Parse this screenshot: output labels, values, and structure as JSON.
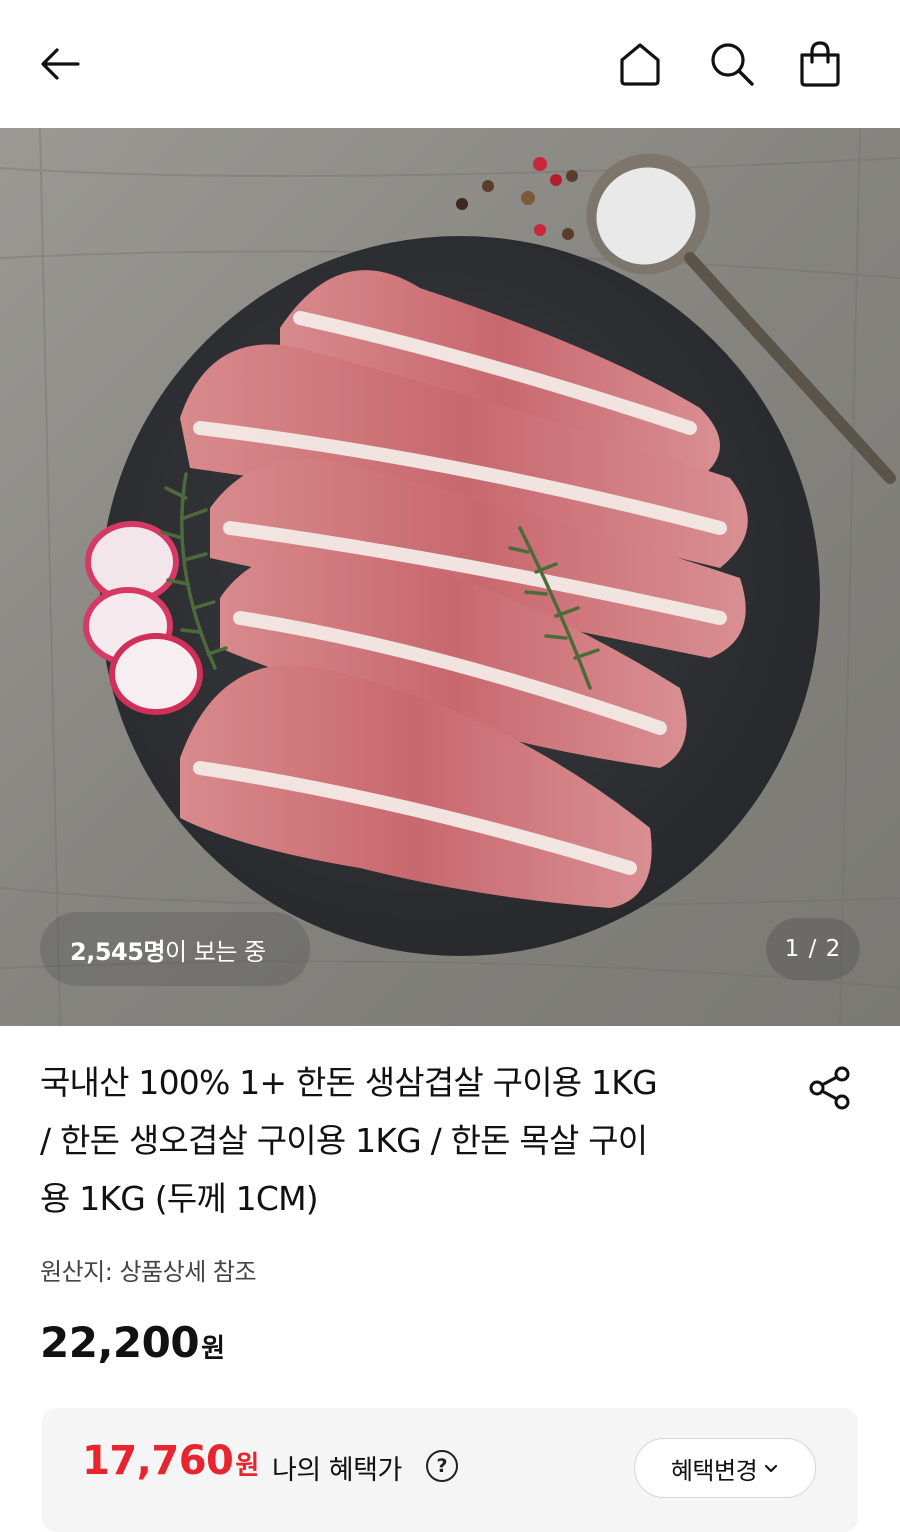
{
  "topbar": {
    "back_icon": "arrow-left-icon",
    "home_icon": "home-icon",
    "search_icon": "search-icon",
    "cart_icon": "shopping-bag-icon"
  },
  "hero": {
    "viewers_count": "2,545명",
    "viewers_text": "이 보는 중",
    "pager": "1 / 2"
  },
  "product": {
    "title_lines": [
      "국내산 100% 1+ 한돈 생삼겹살 구이용 1KG",
      "/ 한돈 생오겹살 구이용 1KG / 한돈 목살 구이",
      "용 1KG (두께 1CM)"
    ],
    "share_icon": "share-icon",
    "origin": "원산지: 상품상세 참조",
    "price": "22,200",
    "price_unit": "원"
  },
  "benefit": {
    "price": "17,760",
    "price_unit": "원",
    "label": "나의 혜택가",
    "help_icon": "question-circle-icon",
    "help_glyph": "?",
    "change_button": "혜택변경",
    "chevron_icon": "chevron-down-icon",
    "accent_color": "#e8242f"
  }
}
